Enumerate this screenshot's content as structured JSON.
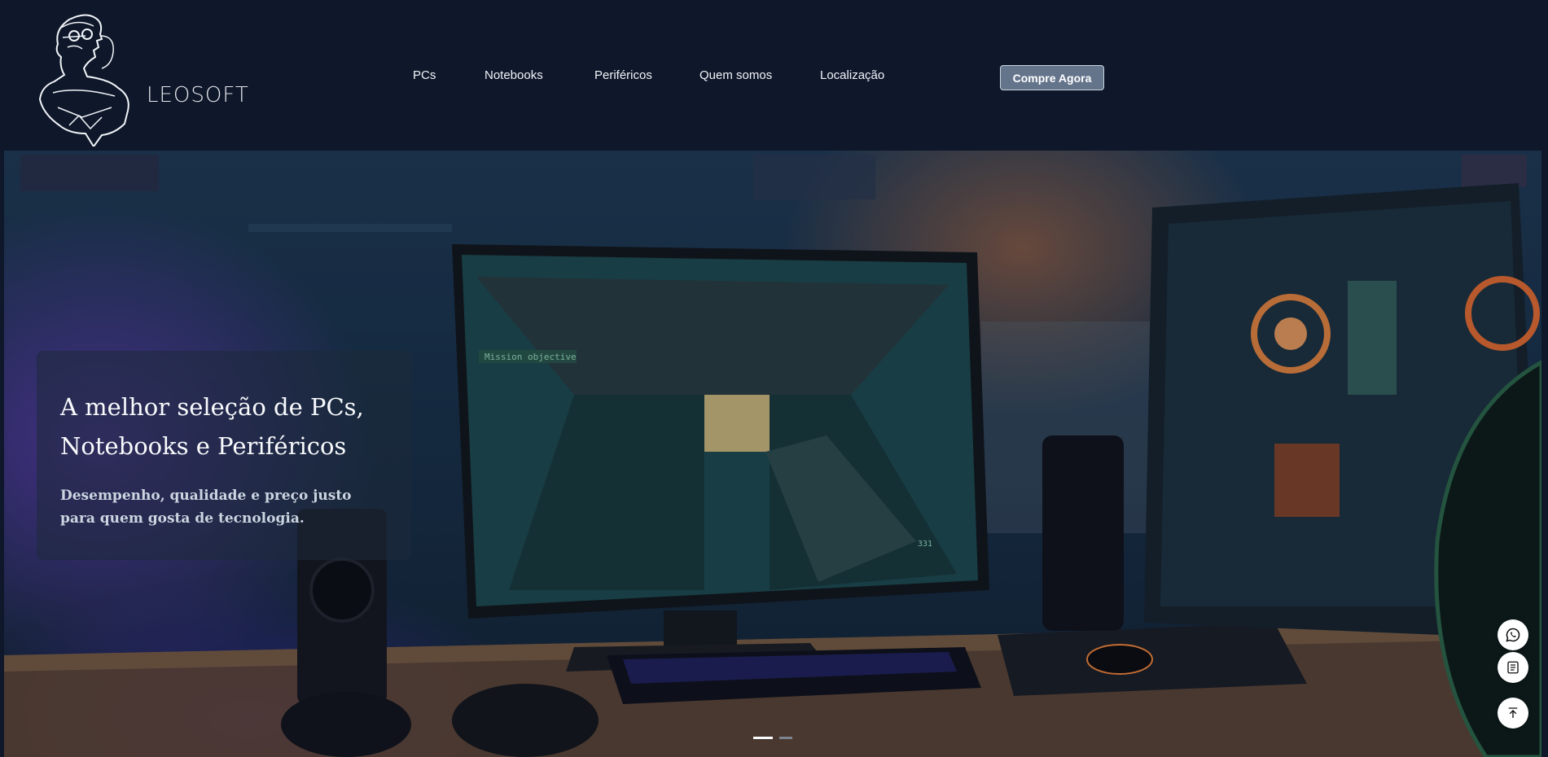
{
  "brand": {
    "name": "LEOSOFT"
  },
  "nav": {
    "items": [
      {
        "label": "PCs"
      },
      {
        "label": "Notebooks"
      },
      {
        "label": "Periféricos"
      },
      {
        "label": "Quem somos"
      },
      {
        "label": "Localização"
      }
    ],
    "cta_label": "Compre Agora"
  },
  "hero": {
    "title": "A melhor seleção de PCs, Notebooks e Periféricos",
    "subtitle": "Desempenho, qualidade e preço justo para quem gosta de tecnologia.",
    "slides_total": 2,
    "active_slide": 1,
    "monitor_hud_text": "Mission objective",
    "ammo_text": "331"
  },
  "floating_actions": [
    {
      "icon": "whatsapp-icon"
    },
    {
      "icon": "catalog-icon"
    },
    {
      "icon": "arrow-up-icon"
    }
  ],
  "colors": {
    "header_bg": "#0f172a",
    "cta_bg": "#64748b",
    "text_light": "#f1f5f9"
  }
}
